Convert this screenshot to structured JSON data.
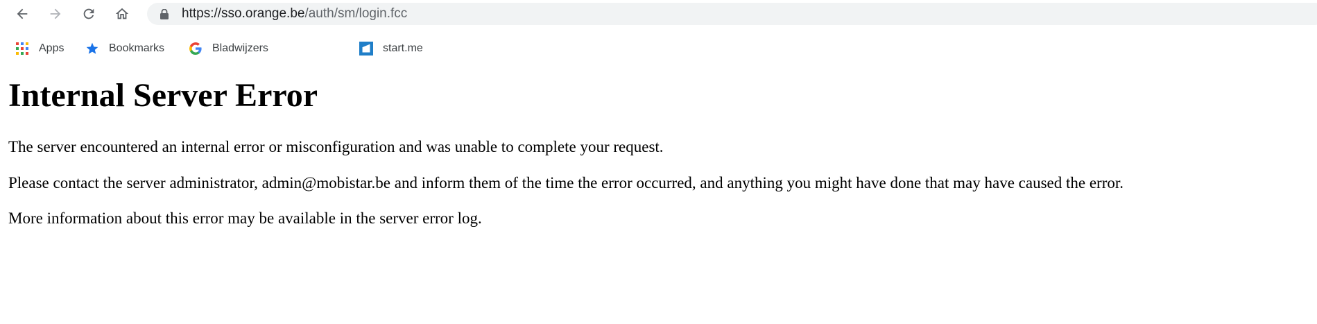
{
  "browser": {
    "url_host": "https://sso.orange.be",
    "url_path": "/auth/sm/login.fcc",
    "icons": {
      "back": "arrow-left-icon",
      "forward": "arrow-right-icon",
      "reload": "reload-icon",
      "home": "home-icon",
      "secure": "lock-icon"
    }
  },
  "bookmarks": [
    {
      "label": "Apps",
      "icon": "apps-grid-icon"
    },
    {
      "label": "Bookmarks",
      "icon": "star-icon"
    },
    {
      "label": "Bladwijzers",
      "icon": "google-icon"
    },
    {
      "label": "start.me",
      "icon": "startme-icon"
    }
  ],
  "page": {
    "title": "Internal Server Error",
    "paragraphs": [
      "The server encountered an internal error or misconfiguration and was unable to complete your request.",
      "Please contact the server administrator, admin@mobistar.be and inform them of the time the error occurred, and anything you might have done that may have caused the error.",
      "More information about this error may be available in the server error log."
    ]
  },
  "colors": {
    "omnibox_bg": "#f1f3f4",
    "icon_grey": "#5f6368",
    "forward_disabled": "#b0b3b8",
    "star_blue": "#1a73e8",
    "startme_blue": "#1f7ec8"
  }
}
